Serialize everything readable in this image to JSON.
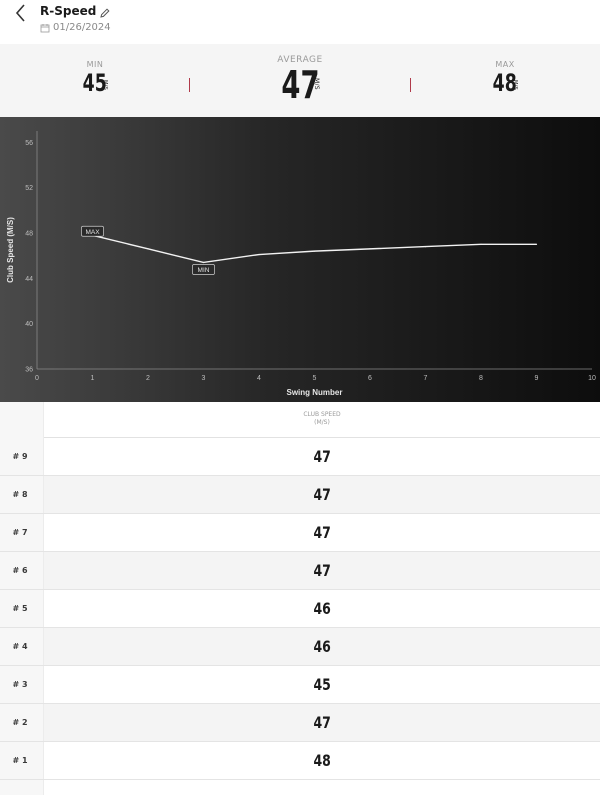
{
  "header": {
    "title": "R-Speed",
    "date": "01/26/2024"
  },
  "stats": {
    "min": {
      "label": "MIN",
      "value": "45",
      "unit": "M/S"
    },
    "average": {
      "label": "AVERAGE",
      "value": "47",
      "unit": "M/S"
    },
    "max": {
      "label": "MAX",
      "value": "48",
      "unit": "M/S"
    }
  },
  "colors": {
    "divider": "#b03a4a",
    "chart_line": "#f2f2f2"
  },
  "chart_data": {
    "type": "line",
    "xlabel": "Swing Number",
    "ylabel": "Club Speed (M/S)",
    "xlim": [
      0,
      10
    ],
    "ylim": [
      36,
      57
    ],
    "x_ticks": [
      0,
      1,
      2,
      3,
      4,
      5,
      6,
      7,
      8,
      9,
      10
    ],
    "y_ticks": [
      36,
      40,
      44,
      48,
      52,
      56
    ],
    "grid": false,
    "series": [
      {
        "x": [
          1,
          2,
          3,
          4,
          5,
          6,
          7,
          8,
          9
        ],
        "y": [
          47.8,
          46.6,
          45.4,
          46.1,
          46.4,
          46.6,
          46.8,
          47.0,
          47.0
        ]
      }
    ],
    "annotations": [
      {
        "text": "MAX",
        "x": 1,
        "y": 47.8
      },
      {
        "text": "MIN",
        "x": 3,
        "y": 45.4
      }
    ]
  },
  "table": {
    "header_line1": "CLUB SPEED",
    "header_line2": "(M/S)",
    "rows": [
      {
        "swing": "# 9",
        "speed": "47"
      },
      {
        "swing": "# 8",
        "speed": "47"
      },
      {
        "swing": "# 7",
        "speed": "47"
      },
      {
        "swing": "# 6",
        "speed": "47"
      },
      {
        "swing": "# 5",
        "speed": "46"
      },
      {
        "swing": "# 4",
        "speed": "46"
      },
      {
        "swing": "# 3",
        "speed": "45"
      },
      {
        "swing": "# 2",
        "speed": "47"
      },
      {
        "swing": "# 1",
        "speed": "48"
      }
    ]
  }
}
